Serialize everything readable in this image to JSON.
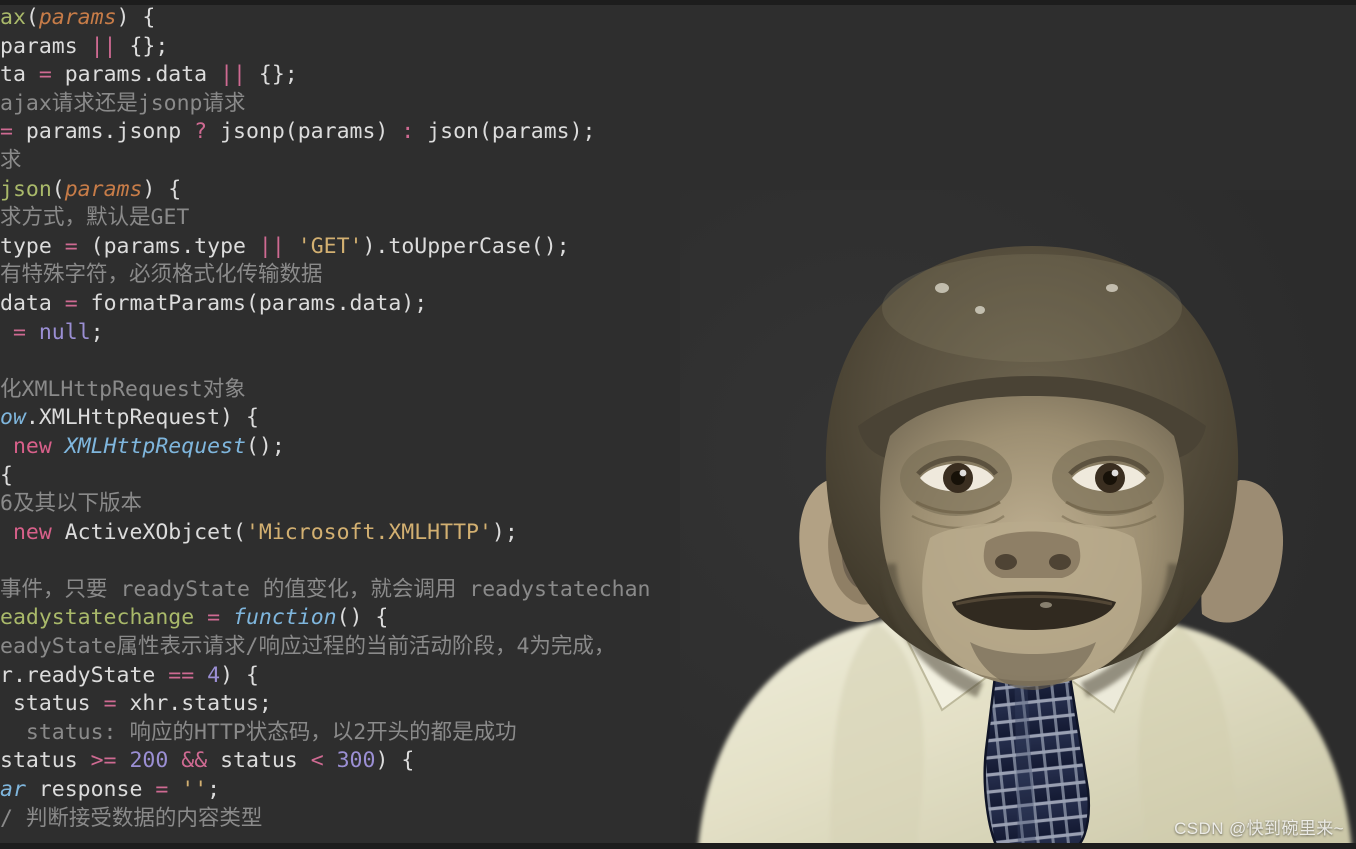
{
  "theme": {
    "background": "#2e2e2e",
    "edge_band": "#1d1d1d",
    "default_text": "#dcdcdc",
    "comment": "#8a8a8a",
    "keyword": "#d8608a",
    "operator": "#cf6a92",
    "function_name": "#a9b96a",
    "parameter": "#c77c48",
    "type": "#7fb6dd",
    "string": "#d3b071",
    "number": "#9b8fd4"
  },
  "editor": {
    "language": "JavaScript",
    "font_size_px": 21.5,
    "line_height_px": 28.6,
    "lines": [
      {
        "index": 0,
        "text": "ax(params) {",
        "tokens": [
          {
            "t": "ax",
            "c": "t-fn"
          },
          {
            "t": "(",
            "c": "t-punc"
          },
          {
            "t": "params",
            "c": "t-param"
          },
          {
            "t": ") {",
            "c": "t-punc"
          }
        ]
      },
      {
        "index": 1,
        "text": "params || {};",
        "tokens": [
          {
            "t": "params ",
            "c": "t-plain"
          },
          {
            "t": "||",
            "c": "t-op"
          },
          {
            "t": " {};",
            "c": "t-plain"
          }
        ]
      },
      {
        "index": 2,
        "text": "ta = params.data || {};",
        "tokens": [
          {
            "t": "ta ",
            "c": "t-plain"
          },
          {
            "t": "=",
            "c": "t-op"
          },
          {
            "t": " params.data ",
            "c": "t-plain"
          },
          {
            "t": "||",
            "c": "t-op"
          },
          {
            "t": " {};",
            "c": "t-plain"
          }
        ]
      },
      {
        "index": 3,
        "text": "ajax请求还是jsonp请求",
        "tokens": [
          {
            "t": "ajax请求还是jsonp请求",
            "c": "t-com"
          }
        ]
      },
      {
        "index": 4,
        "text": "= params.jsonp ? jsonp(params) : json(params);",
        "tokens": [
          {
            "t": "=",
            "c": "t-op"
          },
          {
            "t": " params.jsonp ",
            "c": "t-plain"
          },
          {
            "t": "?",
            "c": "t-op"
          },
          {
            "t": " jsonp(params) ",
            "c": "t-plain"
          },
          {
            "t": ":",
            "c": "t-op"
          },
          {
            "t": " json(params);",
            "c": "t-plain"
          }
        ]
      },
      {
        "index": 5,
        "text": "求",
        "tokens": [
          {
            "t": "求",
            "c": "t-com"
          }
        ]
      },
      {
        "index": 6,
        "text": "json(params) {",
        "tokens": [
          {
            "t": "json",
            "c": "t-fn"
          },
          {
            "t": "(",
            "c": "t-punc"
          },
          {
            "t": "params",
            "c": "t-param"
          },
          {
            "t": ") {",
            "c": "t-punc"
          }
        ]
      },
      {
        "index": 7,
        "text": "求方式,默认是GET",
        "tokens": [
          {
            "t": "求方式，默认是GET",
            "c": "t-com"
          }
        ]
      },
      {
        "index": 8,
        "text": "type = (params.type || 'GET').toUpperCase();",
        "tokens": [
          {
            "t": "type ",
            "c": "t-plain"
          },
          {
            "t": "=",
            "c": "t-op"
          },
          {
            "t": " (params.type ",
            "c": "t-plain"
          },
          {
            "t": "||",
            "c": "t-op"
          },
          {
            "t": " ",
            "c": "t-plain"
          },
          {
            "t": "'GET'",
            "c": "t-str"
          },
          {
            "t": ").toUpperCase();",
            "c": "t-plain"
          }
        ]
      },
      {
        "index": 9,
        "text": "有特殊字符,必须格式化传输数据",
        "tokens": [
          {
            "t": "有特殊字符，必须格式化传输数据",
            "c": "t-com"
          }
        ]
      },
      {
        "index": 10,
        "text": "data = formatParams(params.data);",
        "tokens": [
          {
            "t": "data ",
            "c": "t-plain"
          },
          {
            "t": "=",
            "c": "t-op"
          },
          {
            "t": " formatParams(params.data);",
            "c": "t-plain"
          }
        ]
      },
      {
        "index": 11,
        "text": "= null;",
        "tokens": [
          {
            "t": " ",
            "c": "t-plain"
          },
          {
            "t": "=",
            "c": "t-op"
          },
          {
            "t": " ",
            "c": "t-plain"
          },
          {
            "t": "null",
            "c": "t-null"
          },
          {
            "t": ";",
            "c": "t-plain"
          }
        ]
      },
      {
        "index": 12,
        "text": "",
        "tokens": []
      },
      {
        "index": 13,
        "text": "化XMLHttpRequest对象",
        "tokens": [
          {
            "t": "化XMLHttpRequest对象",
            "c": "t-com"
          }
        ]
      },
      {
        "index": 14,
        "text": "ow.XMLHttpRequest) {",
        "tokens": [
          {
            "t": "ow",
            "c": "t-type"
          },
          {
            "t": ".XMLHttpRequest) {",
            "c": "t-plain"
          }
        ]
      },
      {
        "index": 15,
        "text": "new XMLHttpRequest();",
        "tokens": [
          {
            "t": " ",
            "c": "t-plain"
          },
          {
            "t": "new",
            "c": "t-kw"
          },
          {
            "t": " ",
            "c": "t-plain"
          },
          {
            "t": "XMLHttpRequest",
            "c": "t-type"
          },
          {
            "t": "();",
            "c": "t-plain"
          }
        ]
      },
      {
        "index": 16,
        "text": "{",
        "tokens": [
          {
            "t": "{",
            "c": "t-plain"
          }
        ]
      },
      {
        "index": 17,
        "text": "6及其以下版本",
        "tokens": [
          {
            "t": "6及其以下版本",
            "c": "t-com"
          }
        ]
      },
      {
        "index": 18,
        "text": "new ActiveXObjcet('Microsoft.XMLHTTP');",
        "tokens": [
          {
            "t": " ",
            "c": "t-plain"
          },
          {
            "t": "new",
            "c": "t-kw"
          },
          {
            "t": " ActiveXObjcet(",
            "c": "t-plain"
          },
          {
            "t": "'Microsoft.XMLHTTP'",
            "c": "t-str"
          },
          {
            "t": ");",
            "c": "t-plain"
          }
        ]
      },
      {
        "index": 19,
        "text": "",
        "tokens": []
      },
      {
        "index": 20,
        "text": "事件,只要 readyState 的值变化,就会调用 readystatechan",
        "tokens": [
          {
            "t": "事件，只要 readyState 的值变化，就会调用 readystatechan",
            "c": "t-com"
          }
        ]
      },
      {
        "index": 21,
        "text": "eadystatechange = function() {",
        "tokens": [
          {
            "t": "eadystatechange",
            "c": "t-prop"
          },
          {
            "t": " ",
            "c": "t-plain"
          },
          {
            "t": "=",
            "c": "t-op"
          },
          {
            "t": " ",
            "c": "t-plain"
          },
          {
            "t": "function",
            "c": "t-type"
          },
          {
            "t": "() {",
            "c": "t-plain"
          }
        ]
      },
      {
        "index": 22,
        "text": "eadyState属性表示请求/响应过程的当前活动阶段,4为完成,",
        "tokens": [
          {
            "t": "eadyState属性表示请求/响应过程的当前活动阶段，4为完成，",
            "c": "t-com"
          }
        ]
      },
      {
        "index": 23,
        "text": "r.readyState == 4) {",
        "tokens": [
          {
            "t": "r.readyState ",
            "c": "t-plain"
          },
          {
            "t": "==",
            "c": "t-op"
          },
          {
            "t": " ",
            "c": "t-plain"
          },
          {
            "t": "4",
            "c": "t-num"
          },
          {
            "t": ") {",
            "c": "t-plain"
          }
        ]
      },
      {
        "index": 24,
        "text": "status = xhr.status;",
        "tokens": [
          {
            "t": " status ",
            "c": "t-plain"
          },
          {
            "t": "=",
            "c": "t-op"
          },
          {
            "t": " xhr.status;",
            "c": "t-plain"
          }
        ]
      },
      {
        "index": 25,
        "text": "status: 响应的HTTP状态码,以2开头的都是成功",
        "tokens": [
          {
            "t": "  status: 响应的HTTP状态码，以2开头的都是成功",
            "c": "t-com"
          }
        ]
      },
      {
        "index": 26,
        "text": "status >= 200 && status < 300) {",
        "tokens": [
          {
            "t": "status ",
            "c": "t-plain"
          },
          {
            "t": ">=",
            "c": "t-op"
          },
          {
            "t": " ",
            "c": "t-plain"
          },
          {
            "t": "200",
            "c": "t-num"
          },
          {
            "t": " ",
            "c": "t-plain"
          },
          {
            "t": "&&",
            "c": "t-op"
          },
          {
            "t": " status ",
            "c": "t-plain"
          },
          {
            "t": "<",
            "c": "t-op"
          },
          {
            "t": " ",
            "c": "t-plain"
          },
          {
            "t": "300",
            "c": "t-num"
          },
          {
            "t": ") {",
            "c": "t-plain"
          }
        ]
      },
      {
        "index": 27,
        "text": "ar response = '';",
        "tokens": [
          {
            "t": "ar",
            "c": "t-type"
          },
          {
            "t": " response ",
            "c": "t-plain"
          },
          {
            "t": "=",
            "c": "t-op"
          },
          {
            "t": " ",
            "c": "t-plain"
          },
          {
            "t": "''",
            "c": "t-str"
          },
          {
            "t": ";",
            "c": "t-plain"
          }
        ]
      },
      {
        "index": 28,
        "text": "/ 判断接受数据的内容类型",
        "tokens": [
          {
            "t": "/ 判断接受数据的内容类型",
            "c": "t-com"
          }
        ]
      }
    ]
  },
  "overlay_image": {
    "name": "chimpanzee-in-shirt-and-tie",
    "description": "Cut-out photo of a chimpanzee wearing a cream dress shirt and a dark navy patterned necktie, overlaid on the right side of the code screenshot",
    "colors": {
      "shirt": "#e4e1c8",
      "shirt_shadow": "#c9c5a6",
      "tie": "#1f2746",
      "tie_pattern": "#b9bdc8",
      "fur_dark": "#4a4436",
      "fur_mid": "#6f6550",
      "face_light": "#b7a98c",
      "face_mid": "#8e8167",
      "ear": "#b9a888",
      "eye": "#2a2118"
    }
  },
  "watermark": {
    "text": "CSDN @快到碗里来~"
  }
}
